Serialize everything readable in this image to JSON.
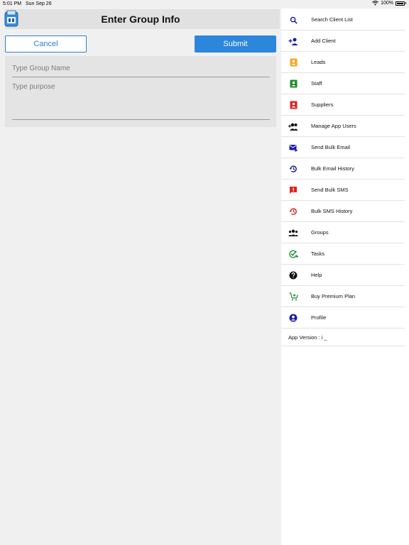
{
  "status": {
    "time": "5:01 PM",
    "date": "Sun Sep 26",
    "battery": "100%"
  },
  "header": {
    "title": "Enter Group Info"
  },
  "buttons": {
    "cancel": "Cancel",
    "submit": "Submit"
  },
  "form": {
    "group_name_placeholder": "Type Group Name",
    "purpose_placeholder": "Type purpose"
  },
  "menu": {
    "items": [
      {
        "label": "Search Client List",
        "icon": "search-icon",
        "color": "#1a1aa8"
      },
      {
        "label": "Add Client",
        "icon": "add-person-icon",
        "color": "#1a1aa8"
      },
      {
        "label": "Leads",
        "icon": "contact-card-icon",
        "color": "#f5a623"
      },
      {
        "label": "Staff",
        "icon": "contact-card-icon",
        "color": "#1e8a2e"
      },
      {
        "label": "Suppliers",
        "icon": "contact-card-icon",
        "color": "#e02020"
      },
      {
        "label": "Manage App Users",
        "icon": "people-add-icon",
        "color": "#111111"
      },
      {
        "label": "Send Bulk Email",
        "icon": "email-send-icon",
        "color": "#1a1aa8"
      },
      {
        "label": "Bulk Email History",
        "icon": "history-icon",
        "color": "#1a1aa8"
      },
      {
        "label": "Send Bulk SMS",
        "icon": "sms-alert-icon",
        "color": "#e02020"
      },
      {
        "label": "Bulk SMS History",
        "icon": "history-icon",
        "color": "#e02020"
      },
      {
        "label": "Groups",
        "icon": "groups-icon",
        "color": "#111111"
      },
      {
        "label": "Tasks",
        "icon": "task-check-icon",
        "color": "#1e8a2e"
      },
      {
        "label": "Help",
        "icon": "help-icon",
        "color": "#111111"
      },
      {
        "label": "Buy Premium Plan",
        "icon": "cart-add-icon",
        "color": "#1e8a2e"
      },
      {
        "label": "Profile",
        "icon": "profile-icon",
        "color": "#1a1aa8"
      }
    ],
    "app_version": "App Version : i _"
  }
}
